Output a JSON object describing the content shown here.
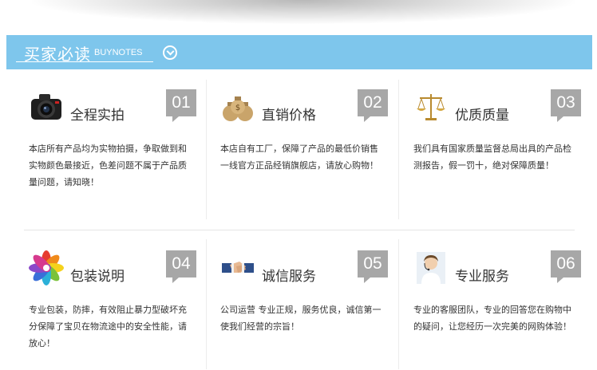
{
  "header": {
    "title": "买家必读",
    "subtitle": "BUYNOTES"
  },
  "cards": [
    {
      "icon": "camera-icon",
      "title": "全程实拍",
      "number": "01",
      "desc": "本店所有产品均为实物拍摄，争取做到和实物颜色最接近，色差问题不属于产品质量问题，请知晓！"
    },
    {
      "icon": "money-bags-icon",
      "title": "直销价格",
      "number": "02",
      "desc": "本店自有工厂，保障了产品的最低价销售一线官方正品经销旗舰店，请放心购物！"
    },
    {
      "icon": "scales-icon",
      "title": "优质质量",
      "number": "03",
      "desc": "我们具有国家质量监督总局出具的产品检测报告，假一罚十，绝对保障质量！"
    },
    {
      "icon": "color-flower-icon",
      "title": "包装说明",
      "number": "04",
      "desc": "专业包装，防摔，有效阻止暴力型破坏充分保障了宝贝在物流途中的安全性能，请放心！"
    },
    {
      "icon": "handshake-icon",
      "title": "诚信服务",
      "number": "05",
      "desc": "公司运营 专业正规，服务优良，诚信第一使我们经营的宗旨！"
    },
    {
      "icon": "service-agent-icon",
      "title": "专业服务",
      "number": "06",
      "desc": "专业的客服团队，专业的回答您在购物中的疑问，让您经历一次完美的网购体验！"
    }
  ],
  "colors": {
    "header_bg": "#7ec6ec",
    "number_bg": "#a7a7a7"
  }
}
